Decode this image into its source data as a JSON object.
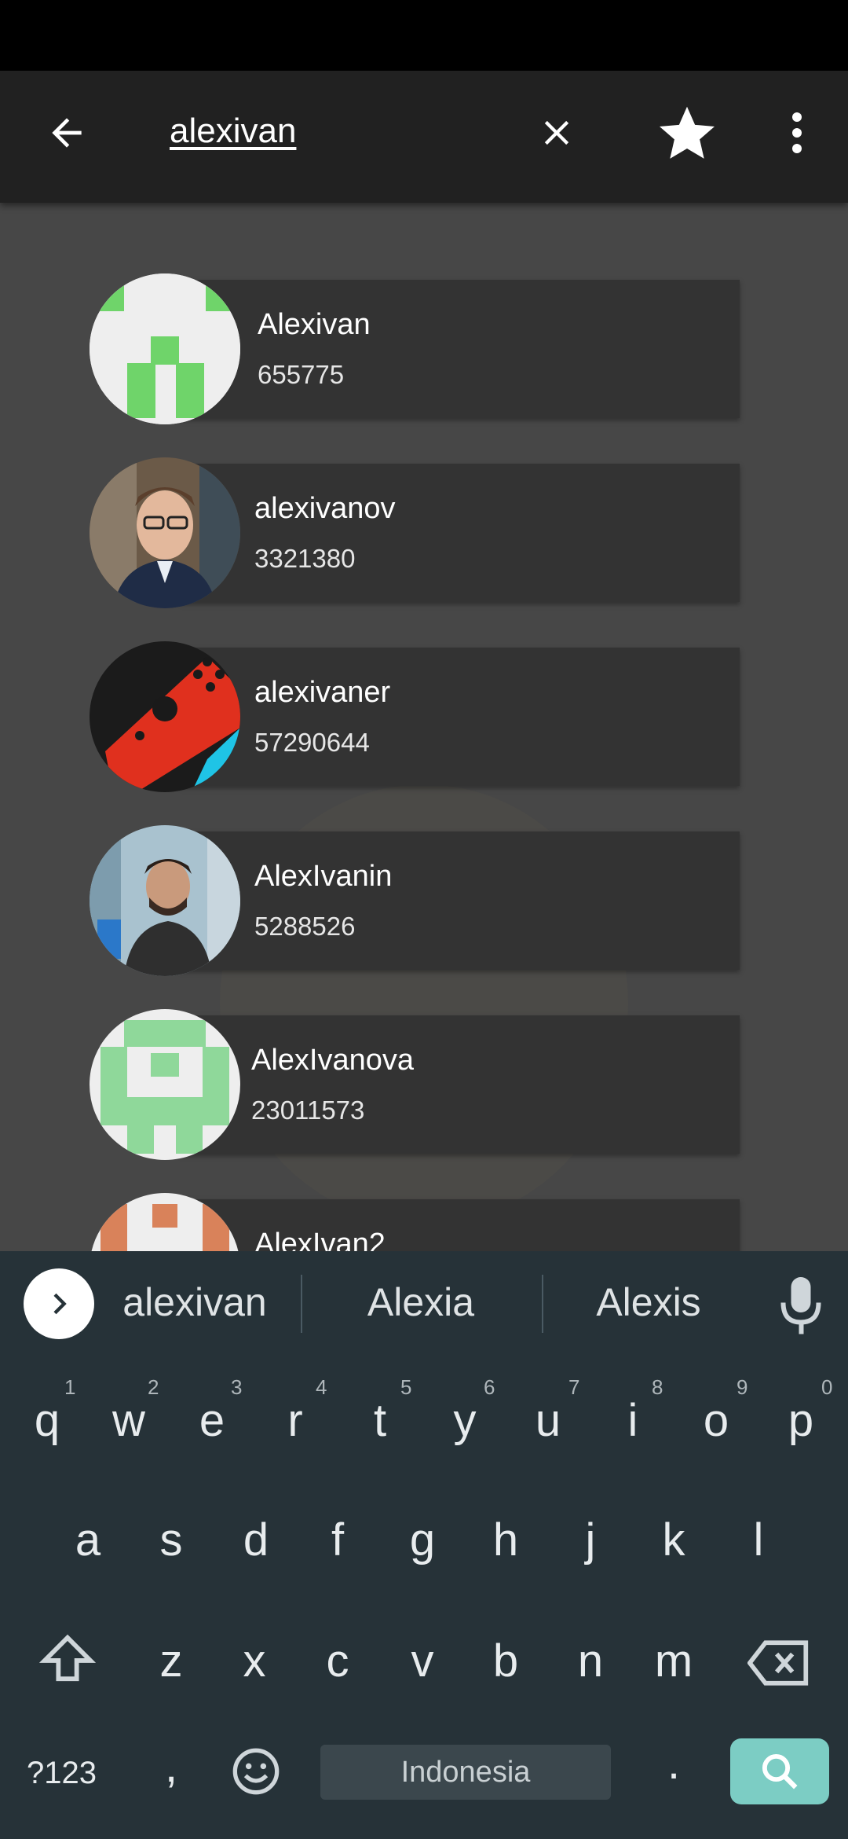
{
  "toolbar": {
    "search_query": "alexivan"
  },
  "results": [
    {
      "name": "Alexivan",
      "number": "655775"
    },
    {
      "name": "alexivanov",
      "number": "3321380"
    },
    {
      "name": "alexivaner",
      "number": "57290644"
    },
    {
      "name": "AlexIvanin",
      "number": "5288526"
    },
    {
      "name": "AlexIvanova",
      "number": "23011573"
    },
    {
      "name": "AlexIvan2",
      "number": ""
    }
  ],
  "keyboard": {
    "suggestions": [
      "alexivan",
      "Alexia",
      "Alexis"
    ],
    "row1": [
      "q",
      "w",
      "e",
      "r",
      "t",
      "y",
      "u",
      "i",
      "o",
      "p"
    ],
    "row1_hints": [
      "1",
      "2",
      "3",
      "4",
      "5",
      "6",
      "7",
      "8",
      "9",
      "0"
    ],
    "row2": [
      "a",
      "s",
      "d",
      "f",
      "g",
      "h",
      "j",
      "k",
      "l"
    ],
    "row3": [
      "z",
      "x",
      "c",
      "v",
      "b",
      "n",
      "m"
    ],
    "symbols_label": "?123",
    "comma": ",",
    "period": ".",
    "space_label": "Indonesia"
  },
  "colors": {
    "appbar": "#212121",
    "keyboard_bg": "#263238",
    "search_key": "#7ccdc4",
    "identicon_green": "#6fd46a",
    "identicon_light_green": "#8fd89a",
    "identicon_orange": "#d9825a"
  }
}
